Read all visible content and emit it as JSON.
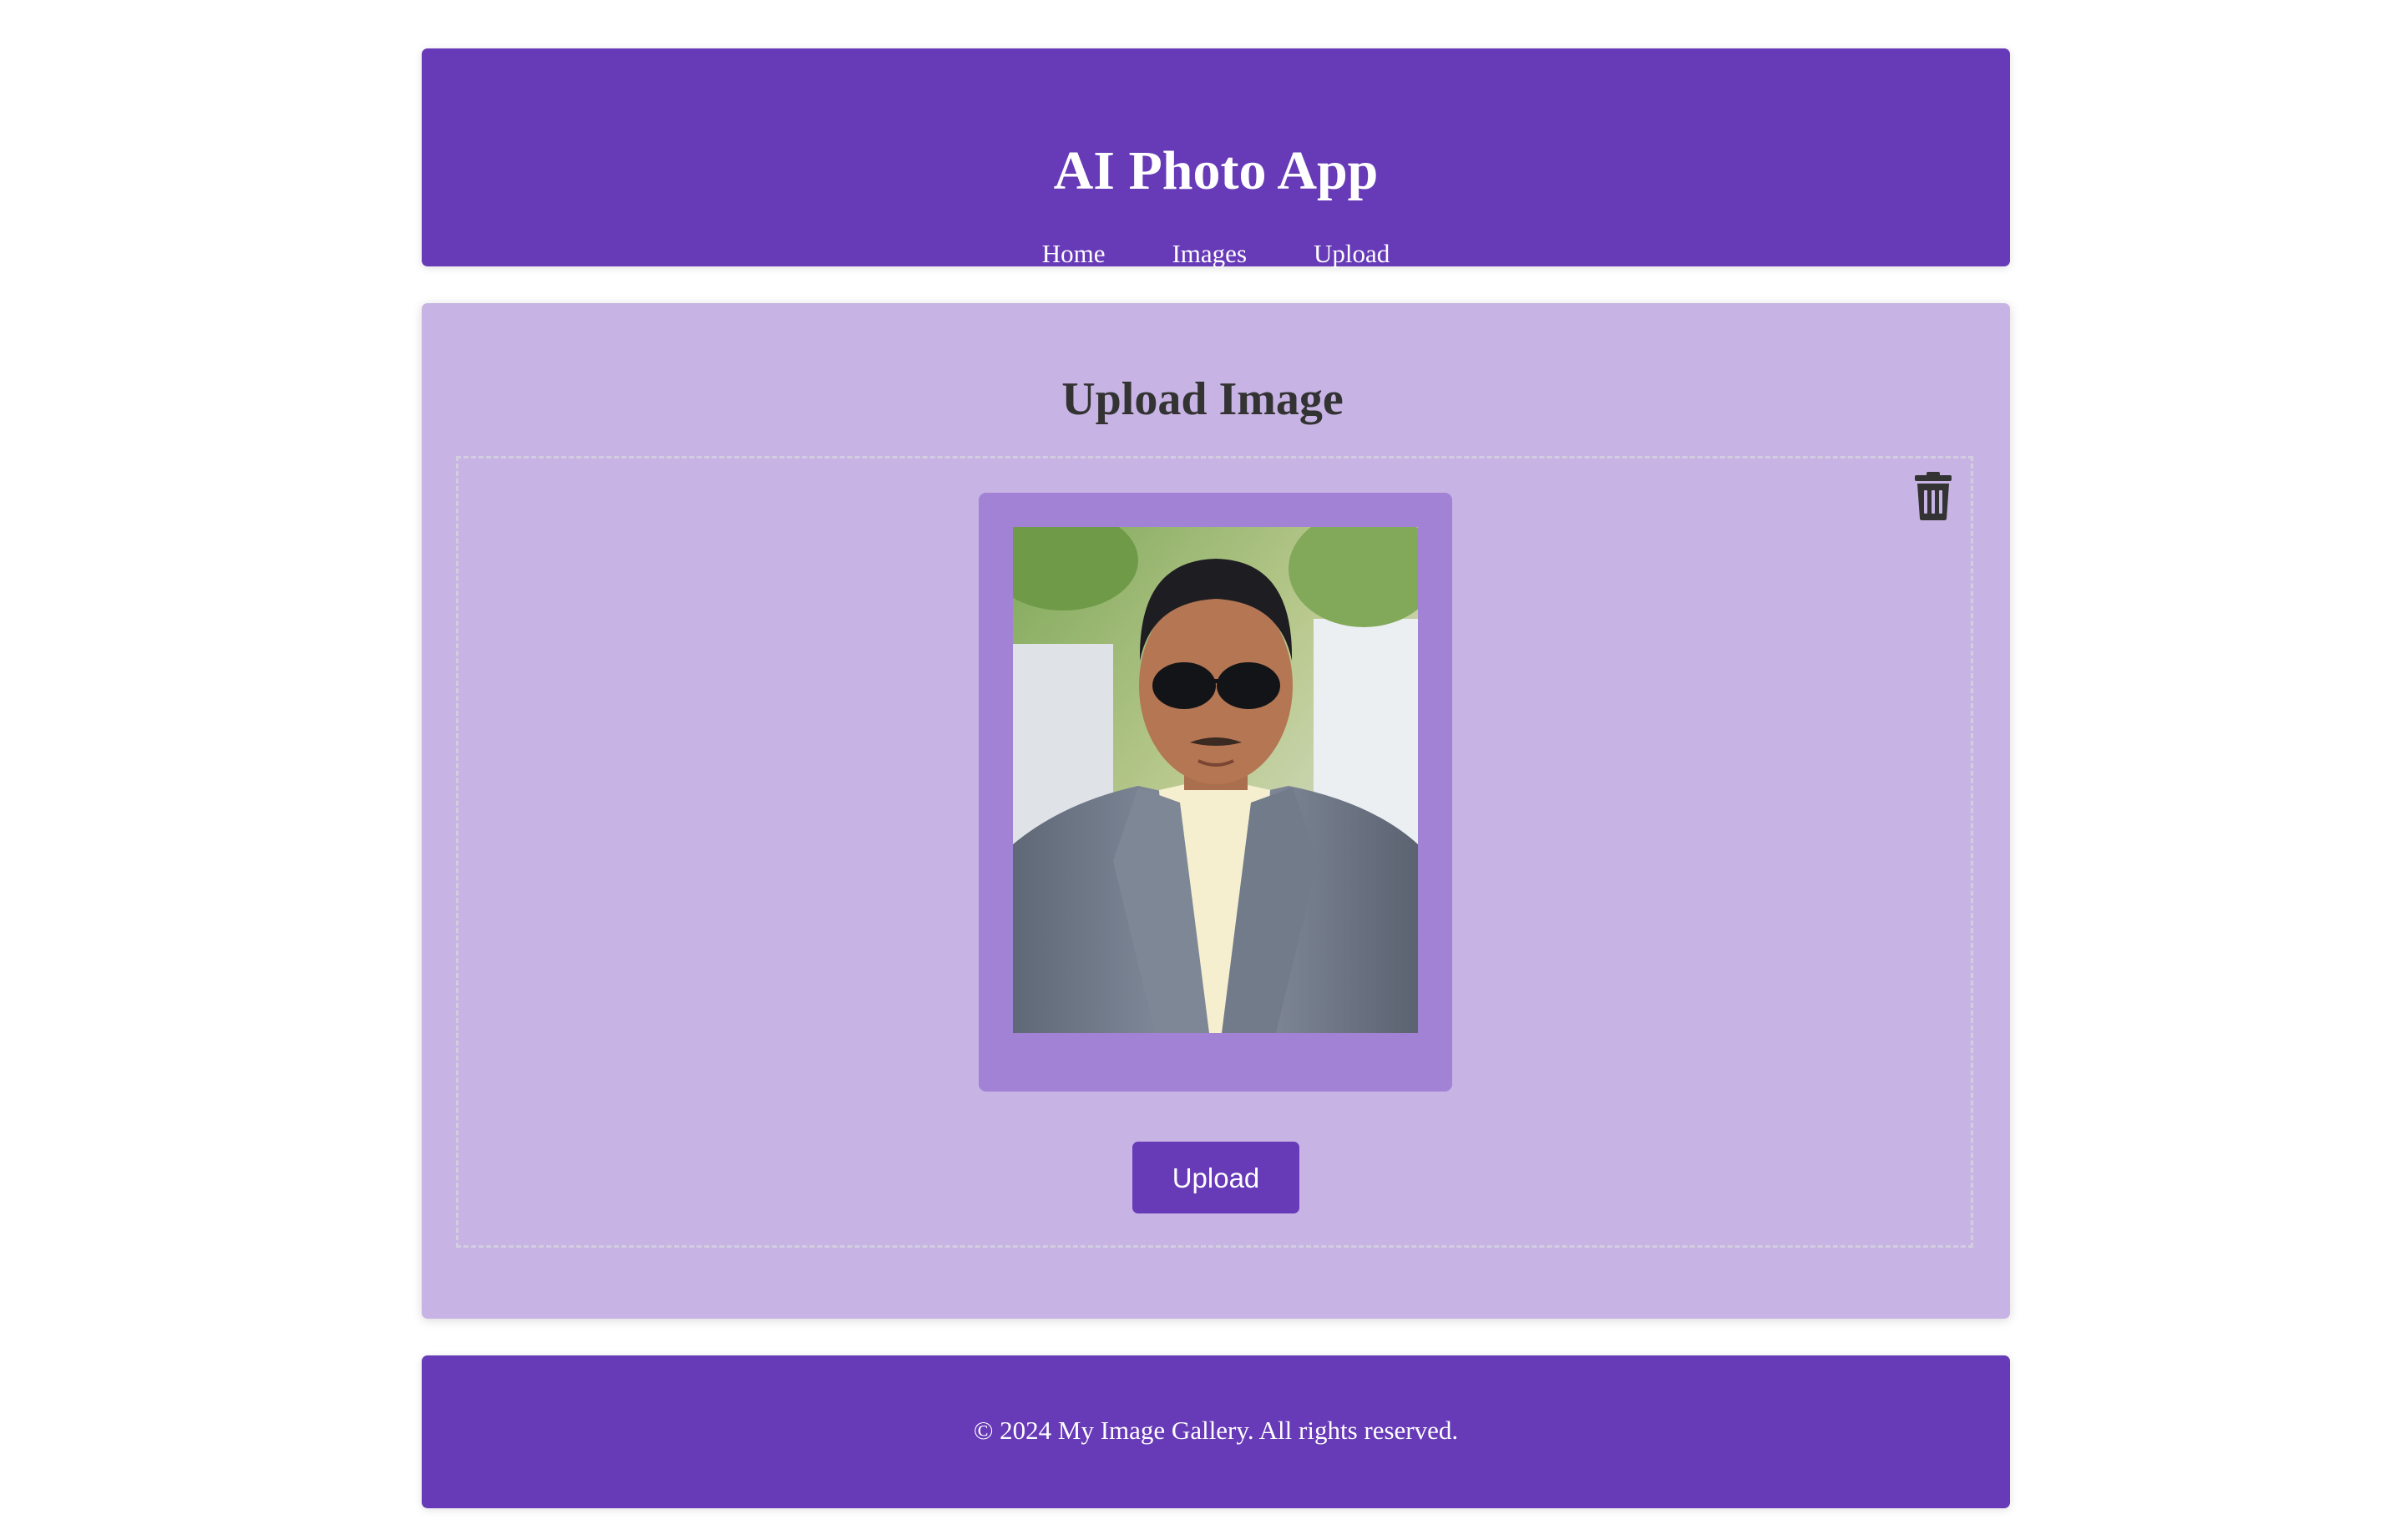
{
  "header": {
    "title": "AI Photo App",
    "nav": [
      "Home",
      "Images",
      "Upload"
    ]
  },
  "main": {
    "title": "Upload Image",
    "delete_icon": "trash-icon",
    "photo_alt": "uploaded portrait photo",
    "upload_button": "Upload"
  },
  "footer": {
    "text": "© 2024 My Image Gallery. All rights reserved."
  },
  "colors": {
    "primary": "#673ab7",
    "panel": "#c7b4e4",
    "frame": "#a182d4",
    "heading": "#333333"
  }
}
